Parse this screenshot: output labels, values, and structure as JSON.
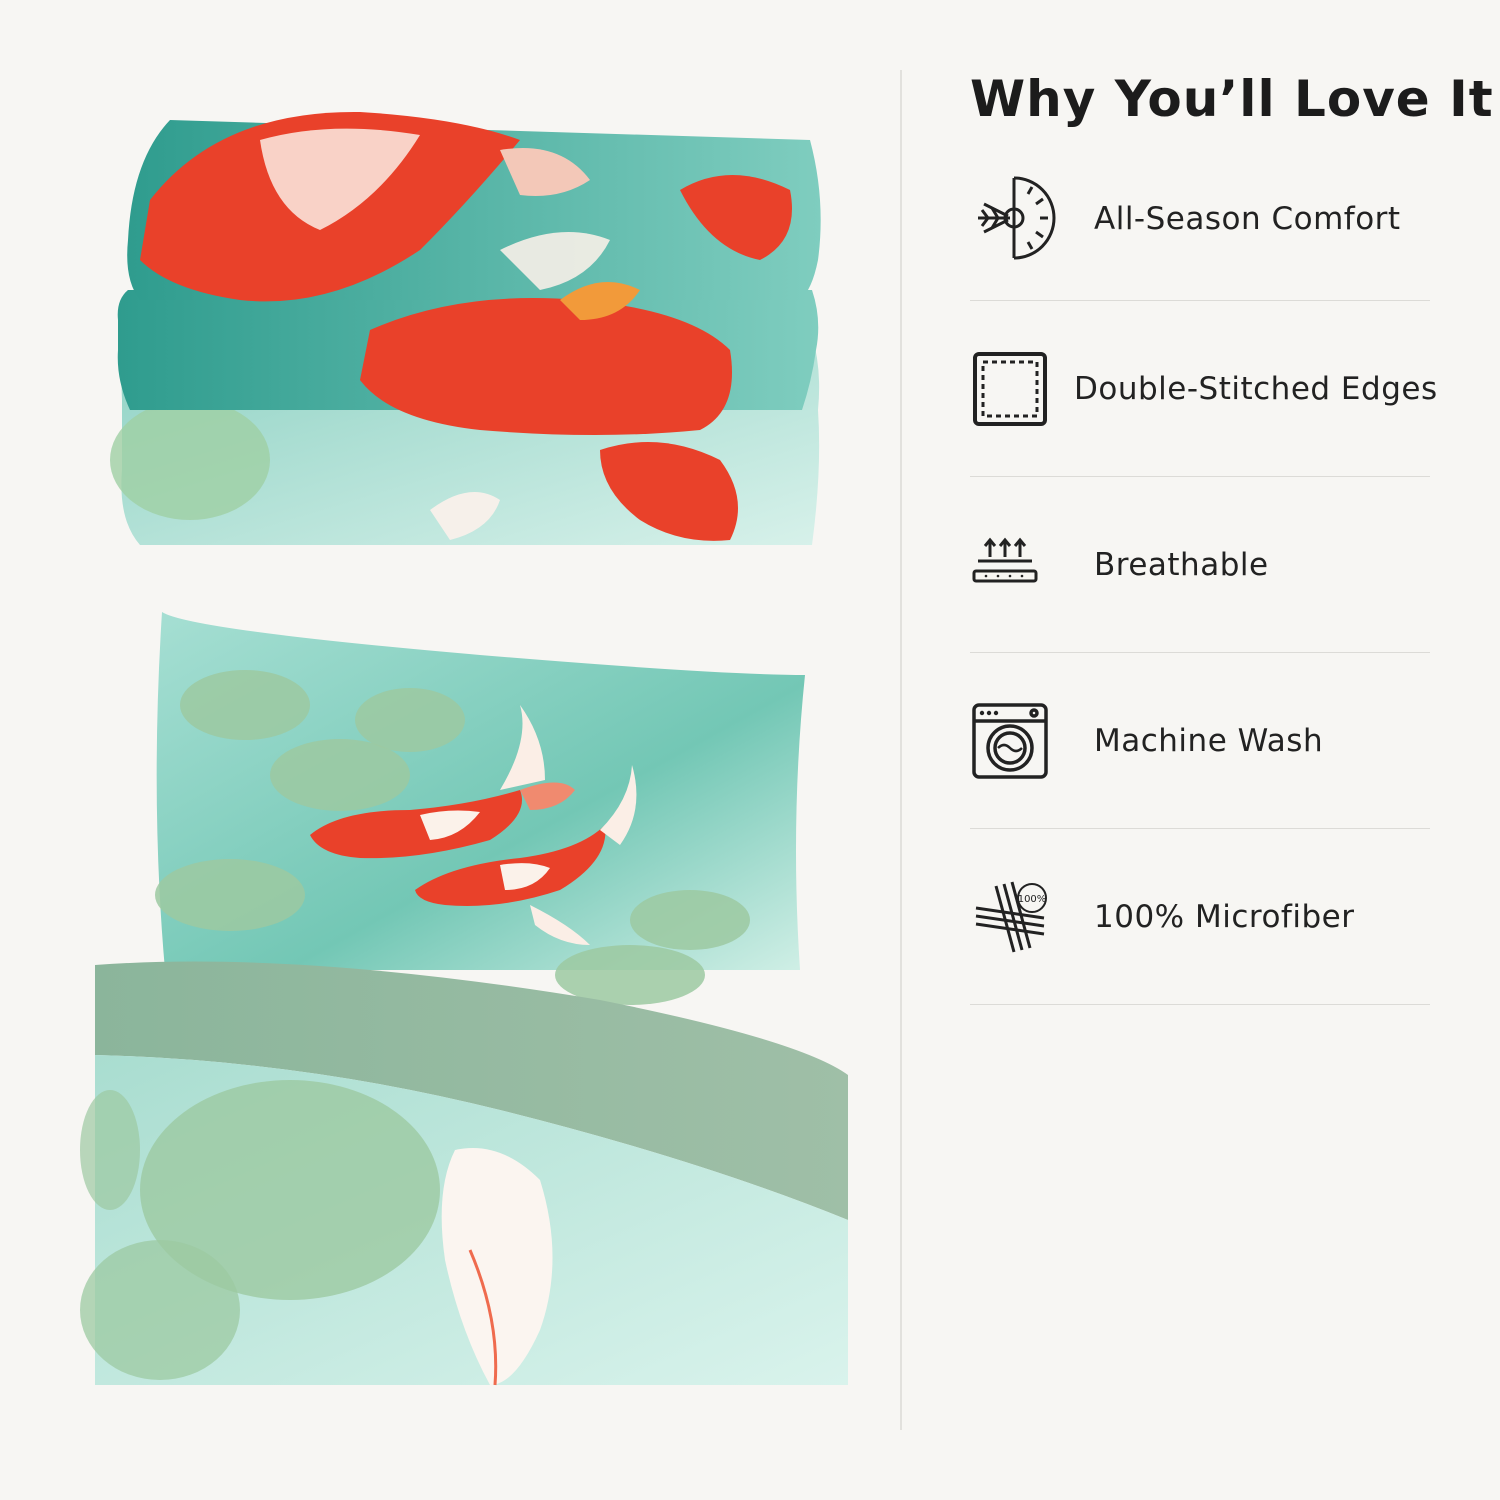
{
  "title": "Why You’ll Love It",
  "features": [
    {
      "label": "All-Season Comfort",
      "icon": "all-season-icon"
    },
    {
      "label": "Double-Stitched Edges",
      "icon": "stitched-edges-icon"
    },
    {
      "label": "Breathable",
      "icon": "breathable-icon"
    },
    {
      "label": "Machine Wash",
      "icon": "washing-machine-icon"
    },
    {
      "label": "100% Microfiber",
      "icon": "microfiber-icon",
      "badge": "100%"
    }
  ],
  "colors": {
    "background": "#f7f6f3",
    "koi_red": "#e9412a",
    "teal": "#3aa597",
    "lily_green": "#9fcca0",
    "sage": "#8fb098"
  }
}
